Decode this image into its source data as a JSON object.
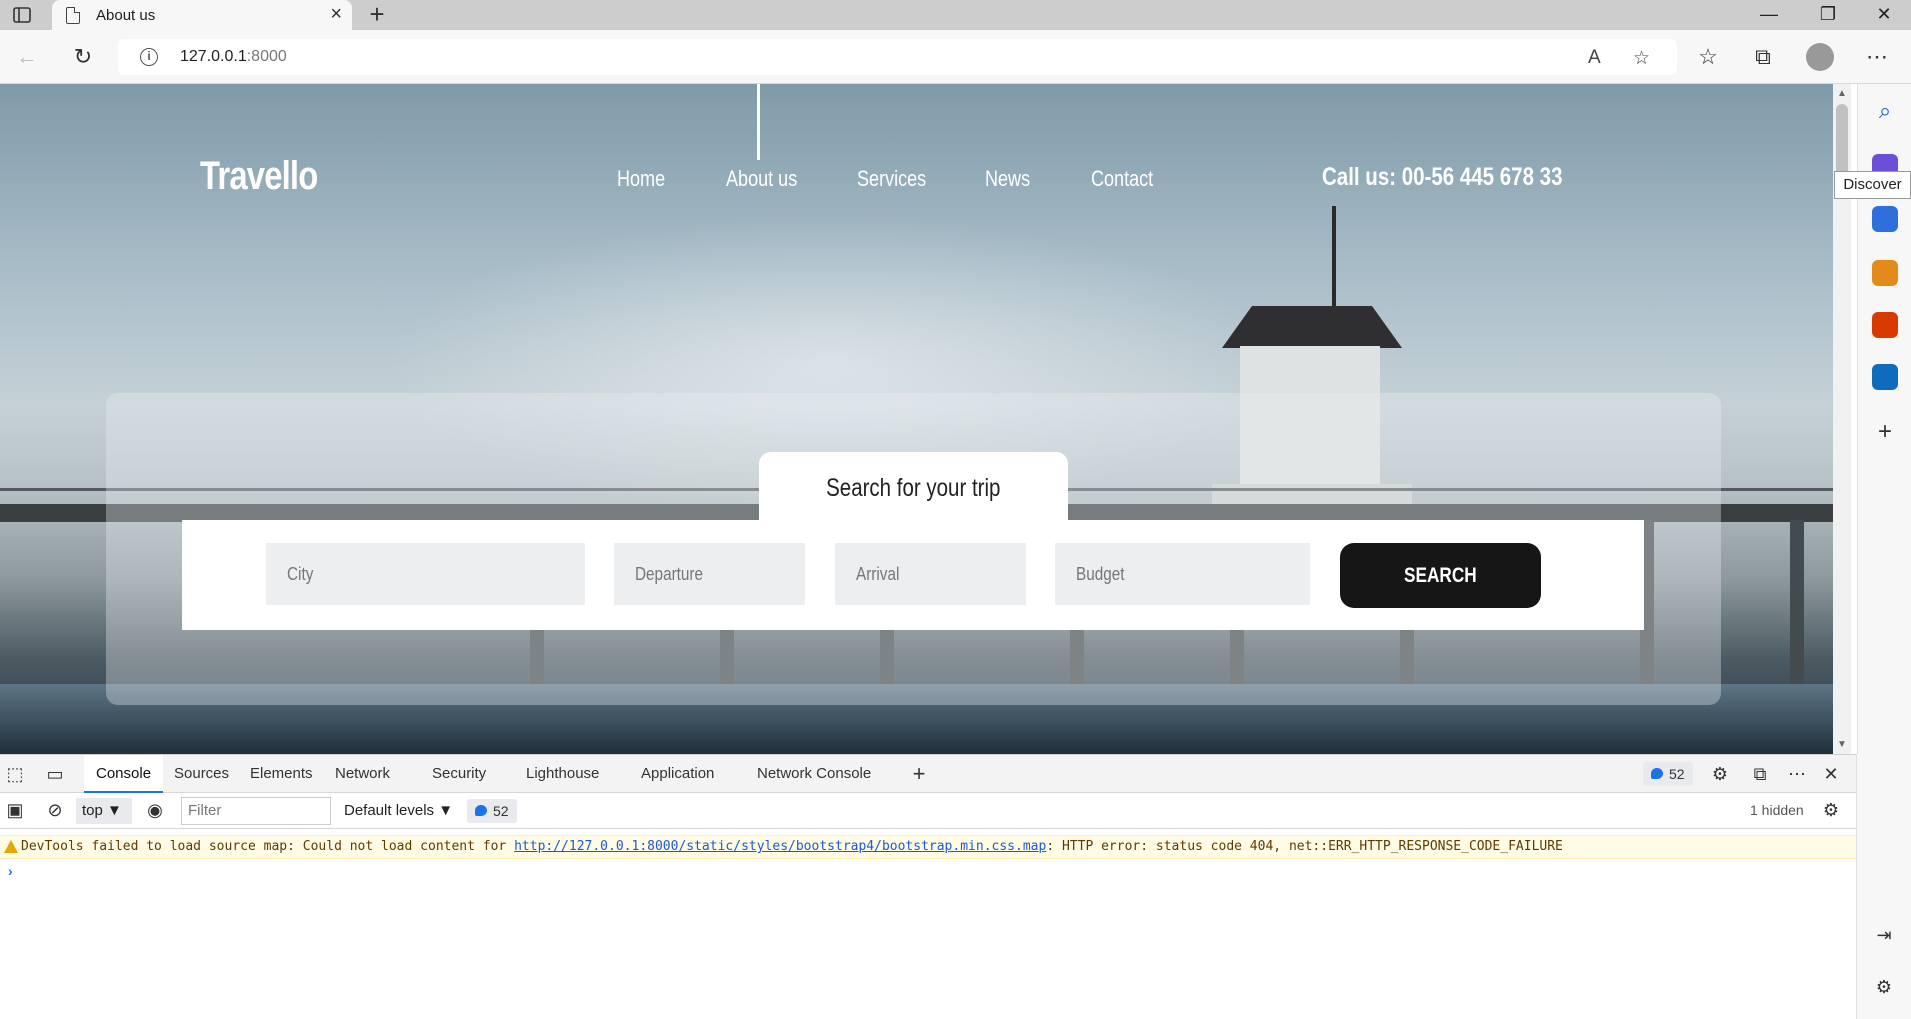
{
  "browser": {
    "tab_title": "About us",
    "address": {
      "host": "127.0.0.1",
      "port": ":8000"
    },
    "tooltip": "Discover"
  },
  "site": {
    "brand": "Travello",
    "nav": [
      "Home",
      "About us",
      "Services",
      "News",
      "Contact"
    ],
    "call_us": "Call us: 00-56 445 678 33",
    "search": {
      "tab_label": "Search for your trip",
      "fields": {
        "city": "City",
        "departure": "Departure",
        "arrival": "Arrival",
        "budget": "Budget"
      },
      "button": "SEARCH"
    }
  },
  "devtools": {
    "tabs": [
      "Console",
      "Sources",
      "Elements",
      "Network",
      "Security",
      "Lighthouse",
      "Application",
      "Network Console"
    ],
    "active_tab": "Console",
    "message_count": "52",
    "context": "top",
    "filter_placeholder": "Filter",
    "levels": "Default levels",
    "hidden": "1 hidden",
    "warning": {
      "prefix": "DevTools failed to load source map: Could not load content for ",
      "link": "http://127.0.0.1:8000/static/styles/bootstrap4/bootstrap.min.css.map",
      "suffix": ": HTTP error: status code 404, net::ERR_HTTP_RESPONSE_CODE_FAILURE"
    }
  },
  "colors": {
    "accent": "#1a73e8",
    "search_button": "#161616",
    "warning_bg": "#fffbe5"
  }
}
